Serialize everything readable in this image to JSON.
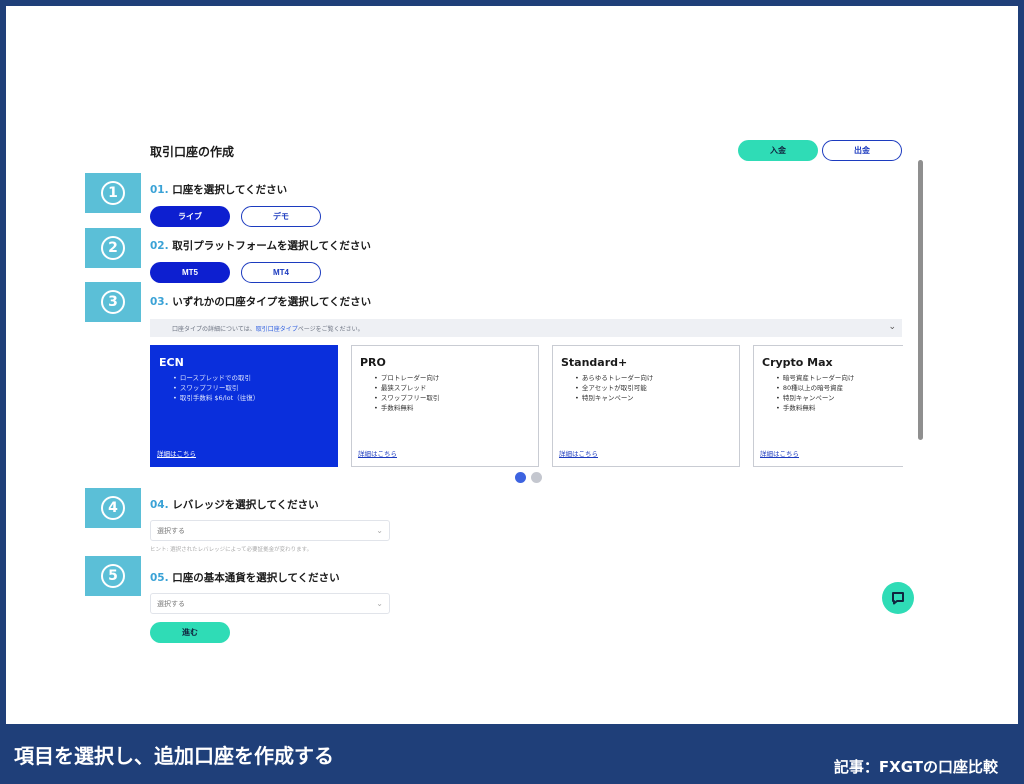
{
  "caption": {
    "main": "項目を選択し、追加口座を作成する",
    "sub": "記事：FXGTの口座比較"
  },
  "page": {
    "title": "取引口座の作成",
    "deposit_label": "入金",
    "withdraw_label": "出金"
  },
  "steps": [
    {
      "badge": "1",
      "num": "01.",
      "label": "口座を選択してください",
      "options": [
        "ライブ",
        "デモ"
      ],
      "selected": "ライブ"
    },
    {
      "badge": "2",
      "num": "02.",
      "label": "取引プラットフォームを選択してください",
      "options": [
        "MT5",
        "MT4"
      ],
      "selected": "MT5"
    },
    {
      "badge": "3",
      "num": "03.",
      "label": "いずれかの口座タイプを選択してください"
    },
    {
      "badge": "4",
      "num": "04.",
      "label": "レバレッジを選択してください",
      "placeholder": "選択する"
    },
    {
      "badge": "5",
      "num": "05.",
      "label": "口座の基本通貨を選択してください",
      "placeholder": "選択する"
    }
  ],
  "info_bar": {
    "prefix": "口座タイプの詳細については、",
    "link": "取引口座タイプ",
    "suffix": "ページをご覧ください。"
  },
  "account_cards": [
    {
      "title": "ECN",
      "selected": true,
      "features": [
        "ロースプレッドでの取引",
        "スワップフリー取引",
        "取引手数料 $6/lot（往復）"
      ],
      "more": "詳細はこちら"
    },
    {
      "title": "PRO",
      "selected": false,
      "features": [
        "プロトレーダー向け",
        "最狭スプレッド",
        "スワップフリー取引",
        "手数料無料"
      ],
      "more": "詳細はこちら"
    },
    {
      "title": "Standard+",
      "selected": false,
      "features": [
        "あらゆるトレーダー向け",
        "全アセットが取引可能",
        "特別キャンペーン"
      ],
      "more": "詳細はこちら"
    },
    {
      "title": "Crypto Max",
      "selected": false,
      "features": [
        "暗号資産トレーダー向け",
        "80種以上の暗号資産",
        "特別キャンペーン",
        "手数料無料"
      ],
      "more": "詳細はこちら"
    }
  ],
  "leverage_hint": "ヒント: 選択されたレバレッジによって必要証拠金が変わります。",
  "next_label": "進む",
  "colors": {
    "accent": "#2fdcb6",
    "primary": "#0d1fd0",
    "step_badge": "#5bbfd7",
    "caption_bg": "#1f3f79"
  },
  "icons": {
    "chat": "chat-bubble-icon",
    "chevron": "chevron-down-icon"
  }
}
